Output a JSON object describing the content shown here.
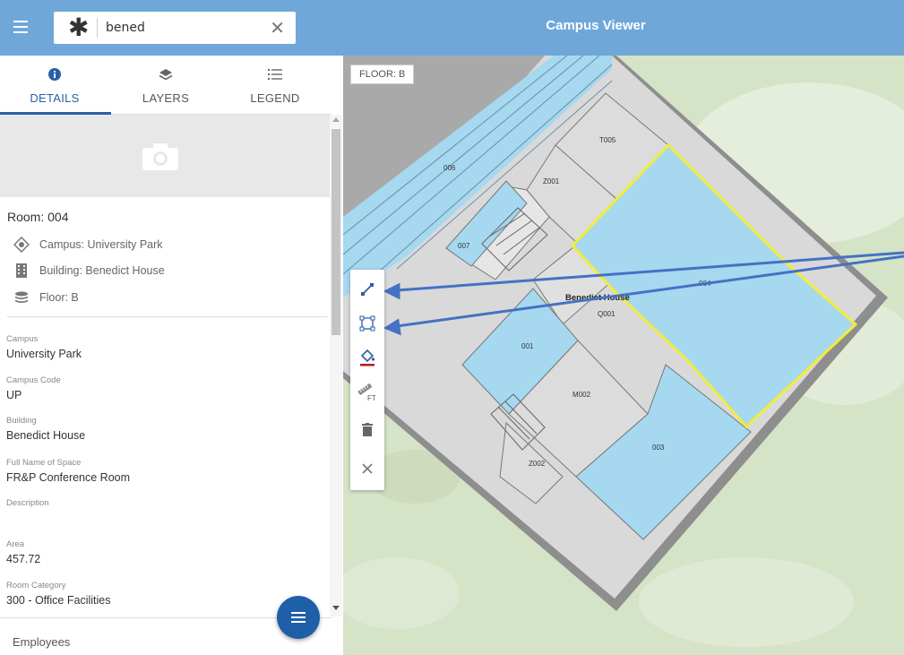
{
  "header": {
    "title": "Campus Viewer",
    "search": {
      "value": "bened",
      "placeholder": ""
    }
  },
  "tabs": [
    {
      "label": "DETAILS",
      "icon": "info-icon"
    },
    {
      "label": "LAYERS",
      "icon": "layers-icon"
    },
    {
      "label": "LEGEND",
      "icon": "legend-list-icon"
    }
  ],
  "details": {
    "room_title": "Room: 004",
    "campus_line": "Campus: University Park",
    "building_line": "Building: Benedict House",
    "floor_line": "Floor: B",
    "fields": [
      {
        "label": "Campus",
        "value": "University Park"
      },
      {
        "label": "Campus Code",
        "value": "UP"
      },
      {
        "label": "Building",
        "value": "Benedict House"
      },
      {
        "label": "Full Name of Space",
        "value": "FR&P Conference Room"
      },
      {
        "label": "Description",
        "value": ""
      },
      {
        "label": "Area",
        "value": "457.72"
      },
      {
        "label": "Room Category",
        "value": "300 - Office Facilities"
      }
    ],
    "employees_label": "Employees"
  },
  "map": {
    "floor_badge": "FLOOR: B",
    "building_label": "Benedict House",
    "rooms": [
      "006",
      "T005",
      "Z001",
      "007",
      "004",
      "Q001",
      "001",
      "M002",
      "003",
      "Z002"
    ]
  },
  "toolbar": {
    "tools": [
      "measure-distance-icon",
      "measure-area-icon",
      "fill-color-icon",
      "units-ft-icon",
      "trash-icon",
      "close-icon"
    ],
    "units_label": "FT"
  },
  "colors": {
    "header": "#6fa7d9",
    "accent": "#2a5fa6",
    "room_fill": "#a6d8f0",
    "selected_outline": "#f2ec3a",
    "fab": "#1f5fa8"
  }
}
